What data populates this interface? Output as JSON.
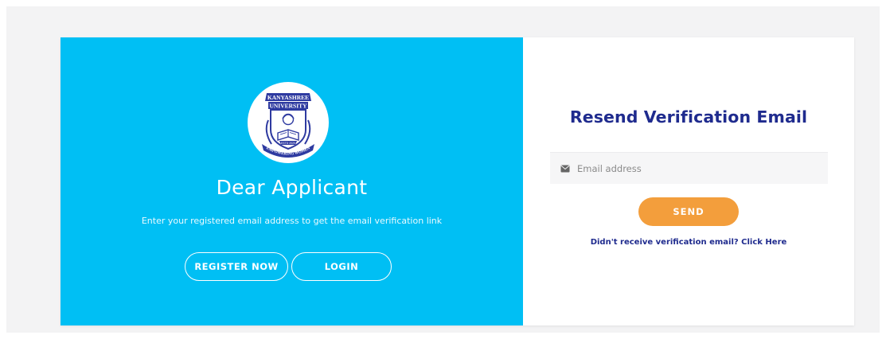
{
  "left_panel": {
    "logo": {
      "top_text": "KANYASHREE",
      "middle_text": "UNIVERSITY",
      "bottom_text": "EMPOWERING WOMEN",
      "ribbon_text": "ESTD 2020"
    },
    "heading": "Dear Applicant",
    "subtitle": "Enter your registered email address to get the email verification link",
    "register_label": "REGISTER NOW",
    "login_label": "LOGIN"
  },
  "right_panel": {
    "title": "Resend Verification Email",
    "email_placeholder": "Email address",
    "send_label": "SEND",
    "link_text": "Didn't receive verification email? Click Here"
  },
  "colors": {
    "left_background": "#00bff4",
    "title_color": "#1f2b8e",
    "send_button": "#f39e3c"
  },
  "icons": {
    "email": "envelope-icon",
    "logo": "university-crest-logo"
  }
}
